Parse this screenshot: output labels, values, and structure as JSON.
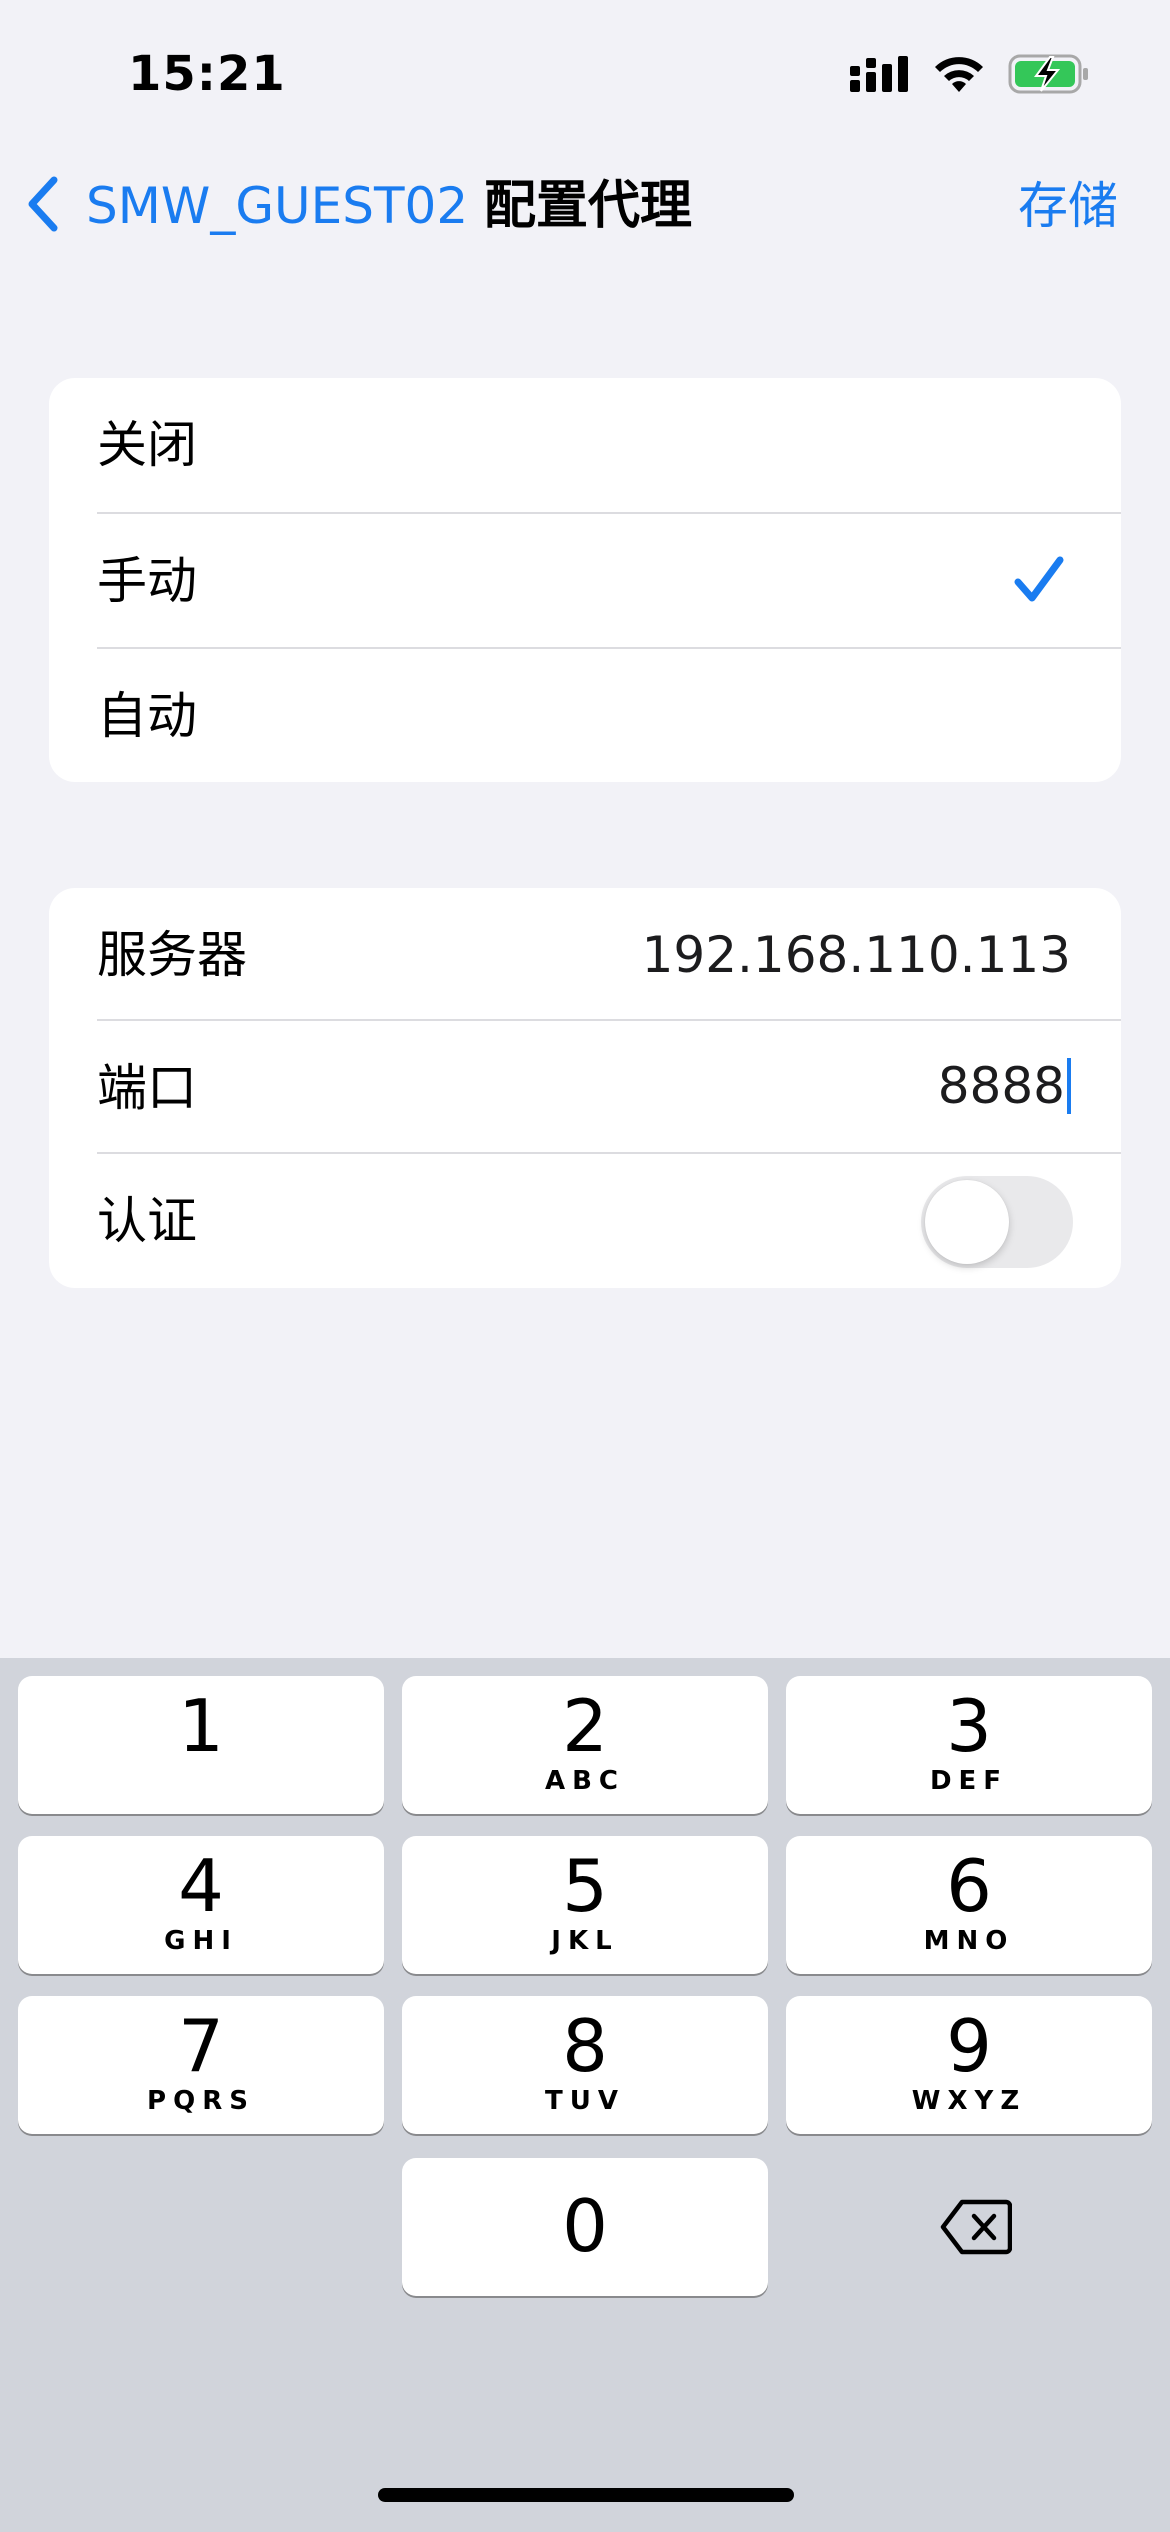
{
  "status_bar": {
    "time": "15:21",
    "icons": [
      "signal-icon",
      "wifi-icon",
      "battery-charging-icon"
    ]
  },
  "nav": {
    "back_label": "SMW_GUEST02",
    "title": "配置代理",
    "save_label": "存储"
  },
  "mode": {
    "options": [
      {
        "label": "关闭"
      },
      {
        "label": "手动"
      },
      {
        "label": "自动"
      }
    ],
    "selected": "手动"
  },
  "proxy": {
    "server_label": "服务器",
    "server_value": "192.168.110.113",
    "port_label": "端口",
    "port_value": "8888",
    "auth_label": "认证",
    "auth_enabled": false
  },
  "keyboard": {
    "keys": [
      {
        "num": "1",
        "letters": ""
      },
      {
        "num": "2",
        "letters": "ABC"
      },
      {
        "num": "3",
        "letters": "DEF"
      },
      {
        "num": "4",
        "letters": "GHI"
      },
      {
        "num": "5",
        "letters": "JKL"
      },
      {
        "num": "6",
        "letters": "MNO"
      },
      {
        "num": "7",
        "letters": "PQRS"
      },
      {
        "num": "8",
        "letters": "TUV"
      },
      {
        "num": "9",
        "letters": "WXYZ"
      },
      {
        "num": "0",
        "letters": ""
      }
    ]
  },
  "colors": {
    "accent": "#1a7cf0",
    "background": "#f2f2f7",
    "keyboard_background": "#d1d4db"
  }
}
